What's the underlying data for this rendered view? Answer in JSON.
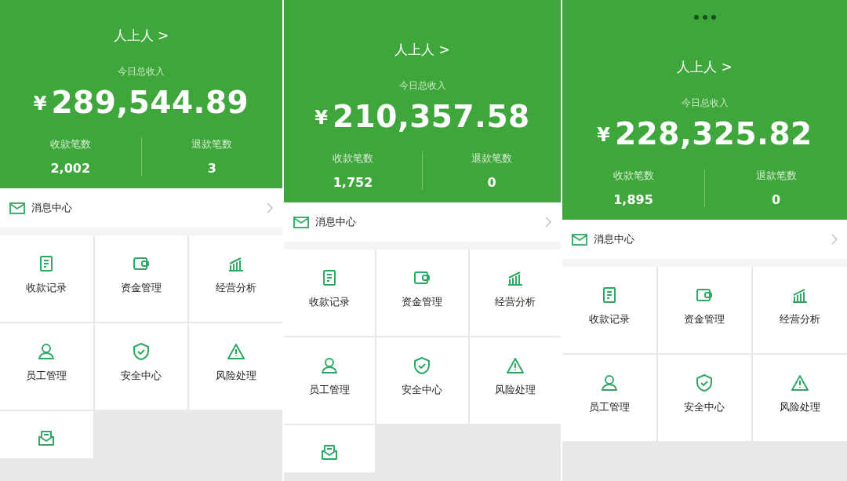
{
  "panels": [
    {
      "menu_dots": false,
      "shop_name": "人上人 >",
      "income_label": "今日总收入",
      "currency": "¥",
      "amount": "289,544.89",
      "stats": [
        {
          "label": "收款笔数",
          "value": "2,002"
        },
        {
          "label": "退款笔数",
          "value": "3"
        }
      ],
      "message_center": "消息中心",
      "tiles": [
        "收款记录",
        "资金管理",
        "经营分析",
        "员工管理",
        "安全中心",
        "风险处理"
      ],
      "partial_tile_visible": true
    },
    {
      "menu_dots": false,
      "shop_name": "人上人 >",
      "income_label": "今日总收入",
      "currency": "¥",
      "amount": "210,357.58",
      "stats": [
        {
          "label": "收款笔数",
          "value": "1,752"
        },
        {
          "label": "退款笔数",
          "value": "0"
        }
      ],
      "message_center": "消息中心",
      "tiles": [
        "收款记录",
        "资金管理",
        "经营分析",
        "员工管理",
        "安全中心",
        "风险处理"
      ],
      "partial_tile_visible": true
    },
    {
      "menu_dots": true,
      "shop_name": "人上人 >",
      "income_label": "今日总收入",
      "currency": "¥",
      "amount": "228,325.82",
      "stats": [
        {
          "label": "收款笔数",
          "value": "1,895"
        },
        {
          "label": "退款笔数",
          "value": "0"
        }
      ],
      "message_center": "消息中心",
      "tiles": [
        "收款记录",
        "资金管理",
        "经营分析",
        "员工管理",
        "安全中心",
        "风险处理"
      ],
      "partial_tile_visible": false
    }
  ]
}
